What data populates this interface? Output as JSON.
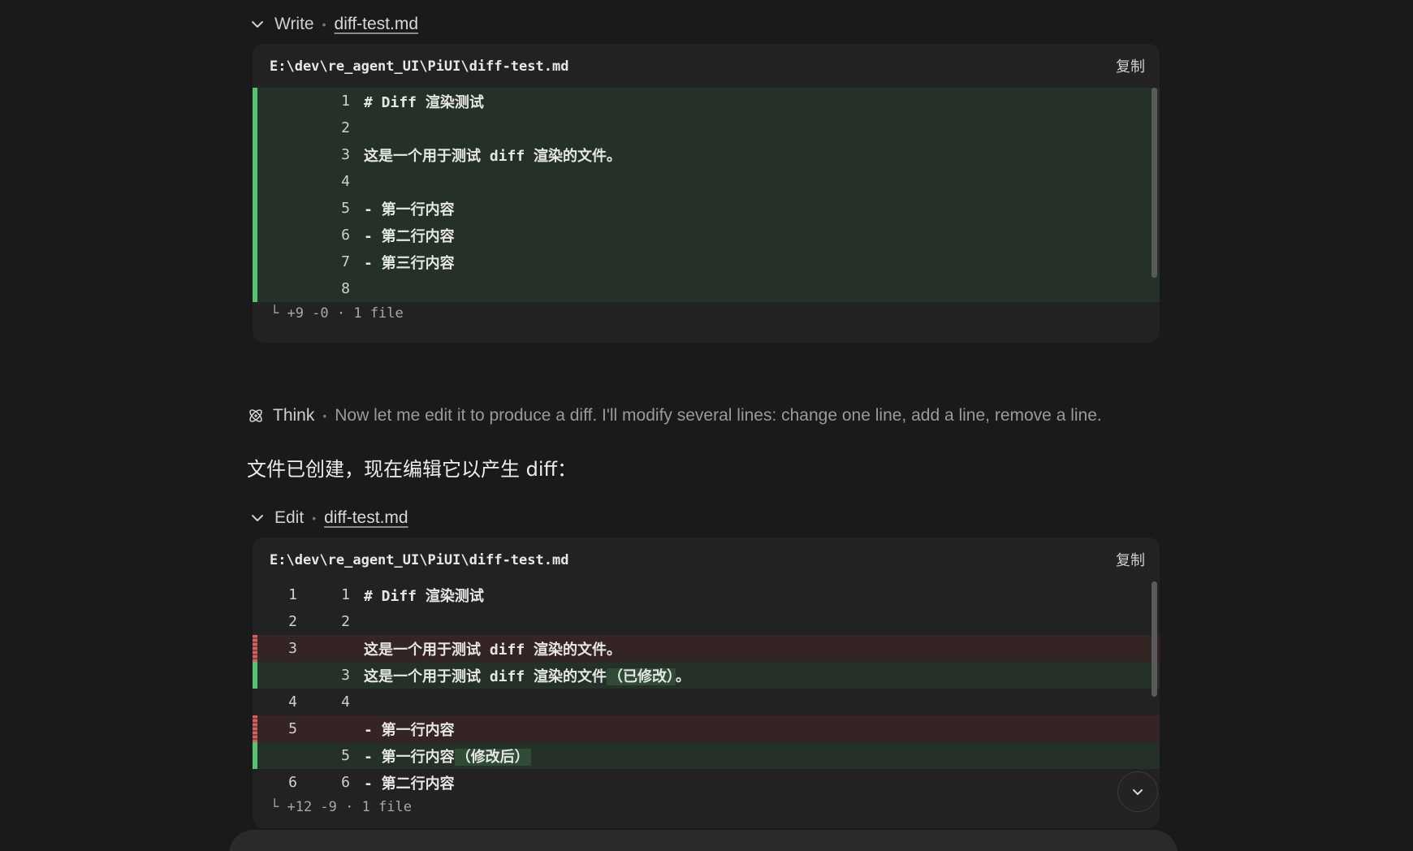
{
  "write_block": {
    "tool_label": "Write",
    "file_name": "diff-test.md",
    "path": "E:\\dev\\re_agent_UI\\PiUI\\diff-test.md",
    "copy_label": "复制",
    "lines": [
      {
        "type": "add",
        "new": "1",
        "text": "# Diff 渲染测试"
      },
      {
        "type": "add",
        "new": "2",
        "text": ""
      },
      {
        "type": "add",
        "new": "3",
        "text": "这是一个用于测试 diff 渲染的文件。"
      },
      {
        "type": "add",
        "new": "4",
        "text": ""
      },
      {
        "type": "add",
        "new": "5",
        "text": "- 第一行内容"
      },
      {
        "type": "add",
        "new": "6",
        "text": "- 第二行内容"
      },
      {
        "type": "add",
        "new": "7",
        "text": "- 第三行内容"
      },
      {
        "type": "add",
        "new": "8",
        "text": ""
      }
    ],
    "summary": "└ +9 -0 · 1 file"
  },
  "think": {
    "label": "Think",
    "text": "Now let me edit it to produce a diff. I'll modify several lines: change one line, add a line, remove a line."
  },
  "assistant_message": "文件已创建，现在编辑它以产生 diff：",
  "edit_block": {
    "tool_label": "Edit",
    "file_name": "diff-test.md",
    "path": "E:\\dev\\re_agent_UI\\PiUI\\diff-test.md",
    "copy_label": "复制",
    "lines": [
      {
        "type": "ctx",
        "old": "1",
        "new": "1",
        "text": "# Diff 渲染测试"
      },
      {
        "type": "ctx",
        "old": "2",
        "new": "2",
        "text": ""
      },
      {
        "type": "del",
        "old": "3",
        "new": "",
        "text": "这是一个用于测试 diff 渲染的文件。"
      },
      {
        "type": "add",
        "old": "",
        "new": "3",
        "text": "这是一个用于测试 diff 渲染的文件",
        "hl": "（已修改）",
        "tail": "。"
      },
      {
        "type": "ctx",
        "old": "4",
        "new": "4",
        "text": ""
      },
      {
        "type": "del",
        "old": "5",
        "new": "",
        "text": "- 第一行内容"
      },
      {
        "type": "add",
        "old": "",
        "new": "5",
        "text": "- 第一行内容",
        "hl": "（修改后）",
        "tail": ""
      },
      {
        "type": "ctx",
        "old": "6",
        "new": "6",
        "text": "- 第二行内容"
      }
    ],
    "summary": "└ +12 -9 · 1 file"
  },
  "icons": {
    "collapse": "chevron-down-icon",
    "think": "atom-icon",
    "scroll_down": "chevron-down-icon"
  },
  "colors": {
    "background": "#1a1a1a",
    "card": "#222222",
    "add_bg": "#253128",
    "del_bg": "#352424",
    "add_marker": "#56c271",
    "del_marker": "#d06262"
  }
}
